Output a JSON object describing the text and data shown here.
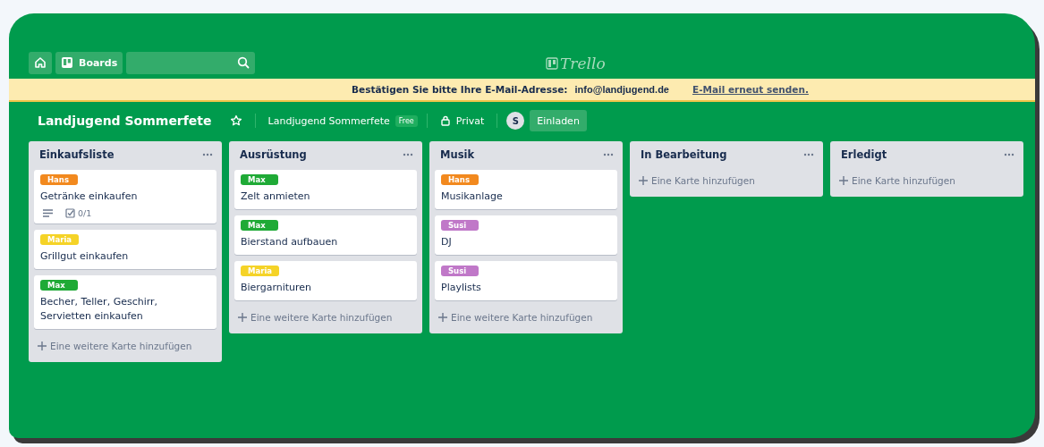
{
  "topbar": {
    "boards_label": "Boards",
    "logo_text": "Trello"
  },
  "banner": {
    "message": "Bestätigen Sie bitte Ihre E-Mail-Adresse:",
    "email": "info@landjugend.de",
    "link": "E-Mail erneut senden."
  },
  "board_header": {
    "title": "Landjugend Sommerfete",
    "starred": false,
    "team": "Landjugend Sommerfete",
    "team_badge": "Free",
    "visibility": "Privat",
    "avatar": "S",
    "invite": "Einladen"
  },
  "lists": [
    {
      "title": "Einkaufsliste",
      "add_label": "Eine weitere Karte hinzufügen",
      "cards": [
        {
          "label": "Hans",
          "color": "#f2891e",
          "title": "Getränke einkaufen",
          "has_description": true,
          "checklist": "0/1"
        },
        {
          "label": "Maria",
          "color": "#f5d327",
          "title": "Grillgut einkaufen"
        },
        {
          "label": "Max",
          "color": "#1faa36",
          "title": "Becher, Teller, Geschirr, Servietten einkaufen"
        }
      ]
    },
    {
      "title": "Ausrüstung",
      "add_label": "Eine weitere Karte hinzufügen",
      "cards": [
        {
          "label": "Max",
          "color": "#1faa36",
          "title": "Zelt anmieten"
        },
        {
          "label": "Max",
          "color": "#1faa36",
          "title": "Bierstand aufbauen"
        },
        {
          "label": "Maria",
          "color": "#f5d327",
          "title": "Biergarnituren"
        }
      ]
    },
    {
      "title": "Musik",
      "add_label": "Eine weitere Karte hinzufügen",
      "cards": [
        {
          "label": "Hans",
          "color": "#f2891e",
          "title": "Musikanlage"
        },
        {
          "label": "Susi",
          "color": "#c078c8",
          "title": "DJ"
        },
        {
          "label": "Susi",
          "color": "#c078c8",
          "title": "Playlists"
        }
      ]
    },
    {
      "title": "In Bearbeitung",
      "add_label": "Eine Karte hinzufügen"
    },
    {
      "title": "Erledigt",
      "add_label": "Eine Karte hinzufügen"
    }
  ]
}
